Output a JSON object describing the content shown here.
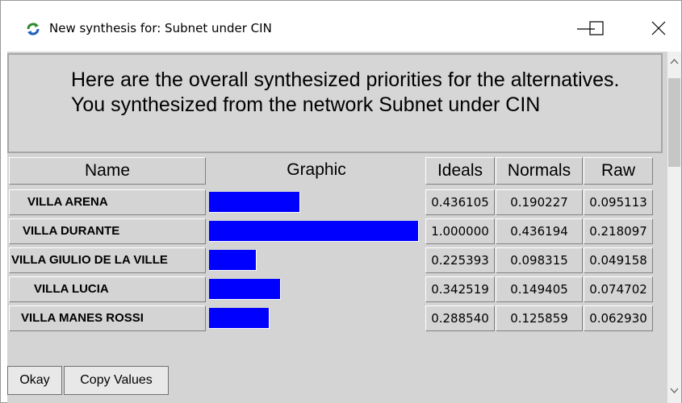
{
  "window": {
    "title": "New synthesis for: Subnet under CIN"
  },
  "header": {
    "message": "Here are the overall synthesized priorities for the alternatives.  You synthesized from the network Subnet under CIN"
  },
  "table": {
    "columns": [
      "Name",
      "Graphic",
      "Ideals",
      "Normals",
      "Raw"
    ],
    "rows": [
      {
        "name": "VILLA ARENA",
        "ideal": "0.436105",
        "normal": "0.190227",
        "raw": "0.095113",
        "ideal_value": 0.436105
      },
      {
        "name": "VILLA DURANTE",
        "ideal": "1.000000",
        "normal": "0.436194",
        "raw": "0.218097",
        "ideal_value": 1.0
      },
      {
        "name": "VILLA GIULIO DE LA VILLE",
        "ideal": "0.225393",
        "normal": "0.098315",
        "raw": "0.049158",
        "ideal_value": 0.225393
      },
      {
        "name": "VILLA LUCIA",
        "ideal": "0.342519",
        "normal": "0.149405",
        "raw": "0.074702",
        "ideal_value": 0.342519
      },
      {
        "name": "VILLA MANES ROSSI",
        "ideal": "0.288540",
        "normal": "0.125859",
        "raw": "0.062930",
        "ideal_value": 0.28854
      }
    ]
  },
  "buttons": {
    "okay": "Okay",
    "copy": "Copy Values"
  },
  "colors": {
    "bar": "#0000ff",
    "panel": "#d4d4d4"
  },
  "icons": {
    "app": "refresh-arrows-icon",
    "minimize": "minimize-icon",
    "maximize": "maximize-icon",
    "close": "close-icon",
    "scroll_up": "chevron-up-icon",
    "scroll_down": "chevron-down-icon"
  }
}
